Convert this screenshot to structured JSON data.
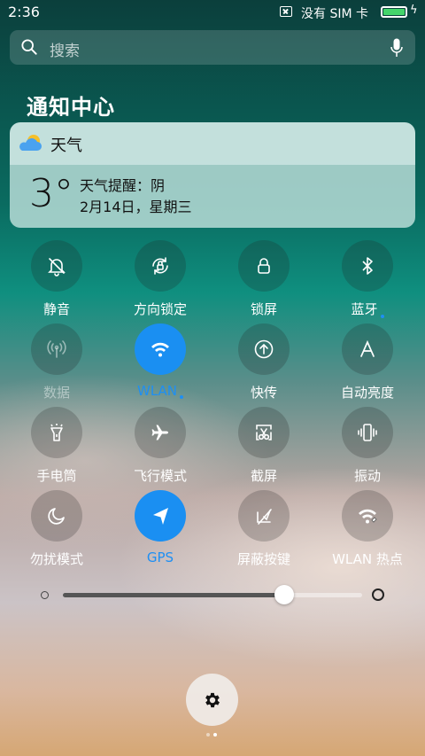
{
  "status": {
    "time": "2:36",
    "sim_text": "没有 SIM 卡",
    "battery_color": "#44d56b",
    "bolt": "ϟ"
  },
  "search": {
    "placeholder": "搜索"
  },
  "notification_center": {
    "title": "通知中心"
  },
  "weather": {
    "label": "天气",
    "temperature": "3°",
    "alert": "天气提醒：阴",
    "date": "2月14日，星期三"
  },
  "tiles": [
    {
      "label": "静音",
      "icon": "bell-off-icon",
      "active": false
    },
    {
      "label": "方向锁定",
      "icon": "rotation-lock-icon",
      "active": false
    },
    {
      "label": "锁屏",
      "icon": "lock-icon",
      "active": false
    },
    {
      "label": "蓝牙",
      "icon": "bluetooth-icon",
      "active": false,
      "dot": true
    },
    {
      "label": "数据",
      "icon": "antenna-icon",
      "active": false,
      "disabled": true
    },
    {
      "label": "WLAN",
      "icon": "wifi-icon",
      "active": true,
      "dot": true
    },
    {
      "label": "快传",
      "icon": "upload-icon",
      "active": false
    },
    {
      "label": "自动亮度",
      "icon": "letter-a-icon",
      "active": false
    },
    {
      "label": "手电筒",
      "icon": "flashlight-icon",
      "active": false
    },
    {
      "label": "飞行模式",
      "icon": "airplane-icon",
      "active": false
    },
    {
      "label": "截屏",
      "icon": "scissors-icon",
      "active": false
    },
    {
      "label": "振动",
      "icon": "vibrate-icon",
      "active": false
    },
    {
      "label": "勿扰模式",
      "icon": "moon-icon",
      "active": false
    },
    {
      "label": "GPS",
      "icon": "location-arrow-icon",
      "active": true
    },
    {
      "label": "屏蔽按键",
      "icon": "block-keys-icon",
      "active": false
    },
    {
      "label": "WLAN 热点",
      "icon": "hotspot-icon",
      "active": false
    }
  ],
  "brightness": {
    "level": 0.74
  },
  "accent_color": "#1a8ff2",
  "settings_icon": "gear-icon",
  "pages": {
    "count": 2,
    "current": 2
  }
}
